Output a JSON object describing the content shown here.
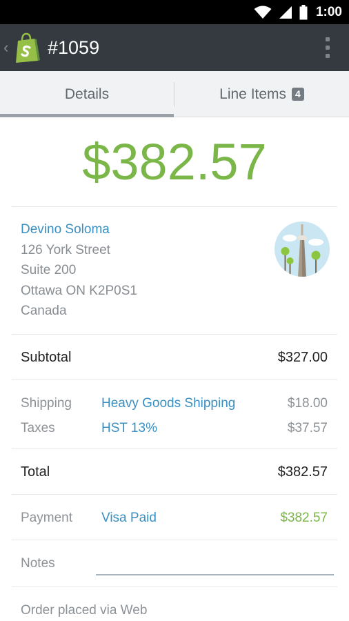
{
  "status_bar": {
    "time": "1:00",
    "icons": [
      "wifi-icon",
      "cell-signal-icon",
      "battery-icon"
    ]
  },
  "app_bar": {
    "title": "#1059",
    "logo_icon": "shopify-bag-icon",
    "menu_icon": "overflow-menu-icon",
    "back_icon": "back-chevron-icon"
  },
  "tabs": [
    {
      "label": "Details",
      "active": true
    },
    {
      "label": "Line Items",
      "badge": "4",
      "active": false
    }
  ],
  "order": {
    "total_display": "$382.57",
    "customer": {
      "name": "Devino Soloma",
      "address_lines": [
        "126 York Street",
        "Suite 200",
        "Ottawa ON K2P0S1",
        "Canada"
      ],
      "illustration_icon": "city-tower-illustration-icon"
    },
    "subtotal": {
      "label": "Subtotal",
      "value": "$327.00"
    },
    "shipping": {
      "label": "Shipping",
      "method": "Heavy Goods Shipping",
      "value": "$18.00"
    },
    "taxes": {
      "label": "Taxes",
      "method": "HST 13%",
      "value": "$37.57"
    },
    "total": {
      "label": "Total",
      "value": "$382.57"
    },
    "payment": {
      "label": "Payment",
      "method": "Visa Paid",
      "value": "$382.57"
    },
    "notes": {
      "label": "Notes",
      "value": ""
    },
    "source": "Order placed via Web"
  },
  "colors": {
    "accent_green": "#7ab648",
    "link_blue": "#3a8fc2",
    "app_bar": "#343a40",
    "status_bar": "#000000"
  }
}
